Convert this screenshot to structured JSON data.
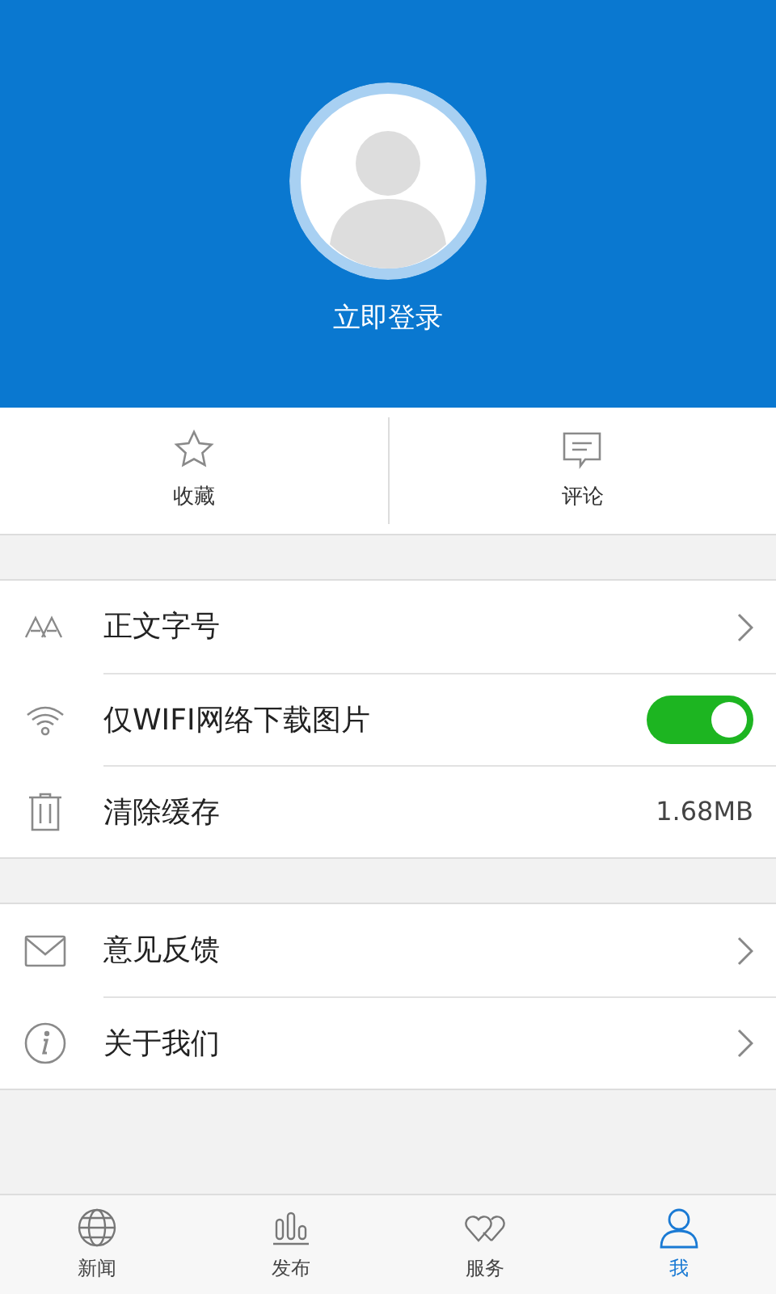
{
  "header": {
    "login_label": "立即登录"
  },
  "quick_actions": [
    {
      "label": "收藏"
    },
    {
      "label": "评论"
    }
  ],
  "settings_groups": [
    {
      "items": [
        {
          "kind": "link",
          "label": "正文字号"
        },
        {
          "kind": "toggle",
          "label": "仅WIFI网络下载图片",
          "on": true
        },
        {
          "kind": "value",
          "label": "清除缓存",
          "value": "1.68MB"
        }
      ]
    },
    {
      "items": [
        {
          "kind": "link",
          "label": "意见反馈"
        },
        {
          "kind": "link",
          "label": "关于我们"
        }
      ]
    }
  ],
  "bottom_nav": [
    {
      "label": "新闻",
      "selected": false
    },
    {
      "label": "发布",
      "selected": false
    },
    {
      "label": "服务",
      "selected": false
    },
    {
      "label": "我",
      "selected": true
    }
  ]
}
